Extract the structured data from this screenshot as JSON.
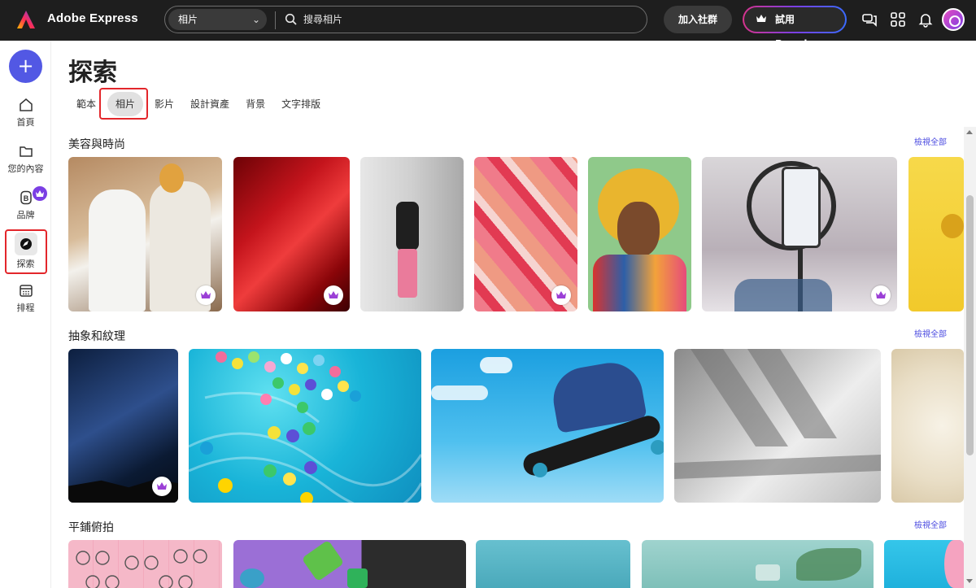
{
  "header": {
    "brand": "Adobe Express",
    "search_scope": "相片",
    "search_placeholder": "搜尋相片",
    "join_label": "加入社群",
    "premium_label": "試用 Premium"
  },
  "sidebar": {
    "items": [
      {
        "label": "首頁",
        "icon": "home-icon"
      },
      {
        "label": "您的內容",
        "icon": "folder-icon"
      },
      {
        "label": "品牌",
        "icon": "brand-icon"
      },
      {
        "label": "探索",
        "icon": "discover-icon"
      },
      {
        "label": "排程",
        "icon": "calendar-icon"
      }
    ]
  },
  "main": {
    "title": "探索",
    "tabs": [
      {
        "label": "範本"
      },
      {
        "label": "相片",
        "active": true
      },
      {
        "label": "影片"
      },
      {
        "label": "設計資產"
      },
      {
        "label": "背景"
      },
      {
        "label": "文字排版"
      }
    ],
    "sections": [
      {
        "title": "美容與時尚",
        "see_all": "檢視全部"
      },
      {
        "title": "抽象和紋理",
        "see_all": "檢視全部"
      },
      {
        "title": "平鋪俯拍",
        "see_all": "檢視全部"
      }
    ]
  },
  "colors": {
    "topbar": "#1e1e1e",
    "accent": "#5258e4",
    "premium": "#7b3fe4",
    "highlight": "#e3262b"
  }
}
